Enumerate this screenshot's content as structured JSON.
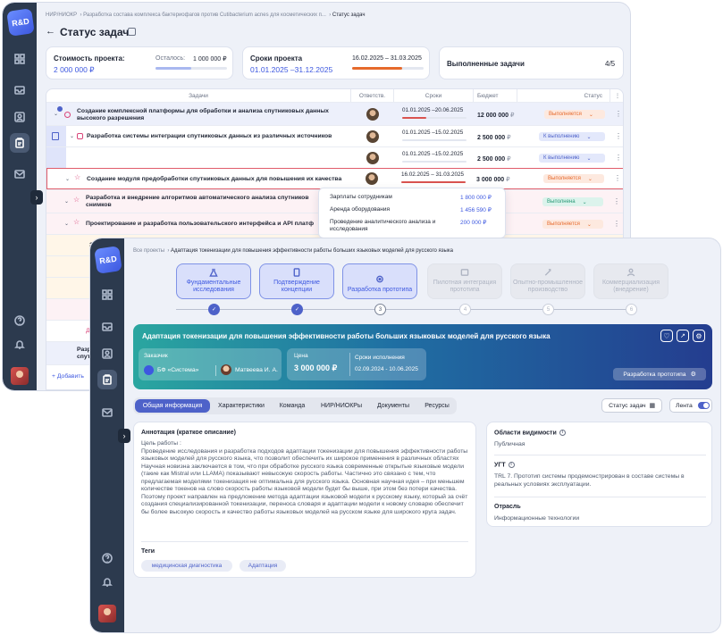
{
  "app": {
    "logo_text": "R&D"
  },
  "tasks_window": {
    "breadcrumb": [
      "НИР/НИОКР",
      "Разработка состава комплекса бактериофагов против Cutibacterium acnes для косметических п...",
      "Статус задач"
    ],
    "title": "Статус задач",
    "cost_card": {
      "label": "Стоимость проекта:",
      "value": "2 000 000 ₽",
      "remaining_label": "Осталось:",
      "remaining_value": "1 000 000 ₽",
      "progress": 0.5
    },
    "terms_card": {
      "label": "Сроки проекта",
      "value": "01.01.2025 –31.12.2025",
      "current_dates": "16.02.2025 – 31.03.2025",
      "progress": 0.7
    },
    "done_card": {
      "label": "Выполненные задачи",
      "value": "4/5"
    },
    "table": {
      "headers": [
        "Задачи",
        "Ответств.",
        "Сроки",
        "Бюджет",
        "Статус"
      ],
      "rows": [
        {
          "task": "Создание комплексной платформы для обработки и анализа спутниковых данных высокого разрешения",
          "dates": "01.01.2025 –20.06.2025",
          "budget": "12 000 000",
          "currency": "₽",
          "status": "Выполняется"
        },
        {
          "task": "Разработка системы интеграции спутниковых данных из различных источников",
          "dates": "01.01.2025 –15.02.2025",
          "budget": "2 500 000",
          "currency": "₽",
          "status": "К выполнению"
        },
        {
          "task": "",
          "dates": "01.01.2025 –15.02.2025",
          "budget": "2 500 000",
          "currency": "₽",
          "status": "К выполнению"
        },
        {
          "task": "Создание модуля предобработки спутниковых данных для повышения их качества",
          "dates": "16.02.2025 – 31.03.2025",
          "budget": "3 000 000",
          "currency": "₽",
          "status": "Выполняется"
        },
        {
          "task": "Разработка и внедрение алгоритмов автоматического анализа спутников снимков",
          "dates": "",
          "budget": "",
          "currency": "₽",
          "status": "Выполнена"
        },
        {
          "task": "Проектирование и разработка пользовательского интерфейса и API платф",
          "dates": "",
          "budget": "",
          "currency": "₽",
          "status": "Выполняется"
        }
      ],
      "partial_rows": [
        "За",
        "Доба",
        "Разра",
        "спутни"
      ],
      "add_label": "Добавить"
    },
    "budget_popup": [
      {
        "label": "Зарплаты сотрудникам",
        "value": "1 800 000 ₽"
      },
      {
        "label": "Аренда оборудования",
        "value": "1 456 590 ₽"
      },
      {
        "label": "Проведение аналитического анализа и исследования",
        "value": "200 000 ₽"
      }
    ]
  },
  "project_window": {
    "breadcrumb": [
      "Все проекты",
      "Адаптация токенизации для повышения эффективности работы больших языковых моделей для русского языка"
    ],
    "stages": [
      {
        "label": "Фундаментальные исследования",
        "num": "1",
        "state": "done"
      },
      {
        "label": "Подтверждение концепции",
        "num": "2",
        "state": "done"
      },
      {
        "label": "Разработка прототипа",
        "num": "3",
        "state": "current"
      },
      {
        "label": "Пилотная интеграция прототипа",
        "num": "4",
        "state": "todo"
      },
      {
        "label": "Опытно-промышленное производство",
        "num": "5",
        "state": "todo"
      },
      {
        "label": "Коммерциализация (внедрение)",
        "num": "6",
        "state": "todo"
      }
    ],
    "banner": {
      "title": "Адаптация токенизации для повышения эффективности работы больших языковых моделей для русского языка",
      "customer_label": "Заказчик",
      "customer": "БФ «Система»",
      "manager": "Матвеева И. А.",
      "price_label": "Цена",
      "price": "3 000 000 ₽",
      "terms_label": "Сроки исполнения",
      "terms": "02.09.2024 - 10.06.2025",
      "stage_button": "Разработка прототипа"
    },
    "tabs": [
      "Общая информация",
      "Характеристики",
      "Команда",
      "НИР/НИОКРы",
      "Документы",
      "Ресурсы"
    ],
    "status_button": "Статус задач",
    "feed_toggle": "Лента",
    "annotation": {
      "title": "Аннотация (краткое описание)",
      "text": "Цель работы :\nПроведение исследования и разработка подходов адаптации токенизации для повышения эффективности работы языковых моделей для русского языка, что позволит обеспечить их широкое применения в различных областях\nНаучная новизна заключается в том, что при обработке русского языка современные открытые языковые модели (такие как Mistral или LLAMA) показывают невысокую скорость работы. Частично это связано с тем, что предлагаемая моделями токенизация не оптимальна для русского языка. Основная научная идея – при меньшем количестве токенов на слово скорость работы языковой модели будет бы выше, при этом без потери качества. Поэтому проект направлен на предложение метода адаптации языковой модели к русскому языку, который за счёт создания специализированной токенизации, переноса словаря и адаптации модели к новому словарю обеспечит бы более высокую скорость и качество работы языковых моделей на русском языке для широкого круга задач.",
      "tags_label": "Теги",
      "tags": [
        "медицинская диагностика",
        "Адаптация"
      ]
    },
    "side": {
      "visibility_label": "Области видимости",
      "visibility": "Публичная",
      "ugt_label": "УГТ",
      "ugt": "TRL 7. Прототип системы продемонстрирован в составе системы в реальных условиях эксплуатации.",
      "field_label": "Отрасль",
      "field": "Информационные технологии"
    }
  }
}
